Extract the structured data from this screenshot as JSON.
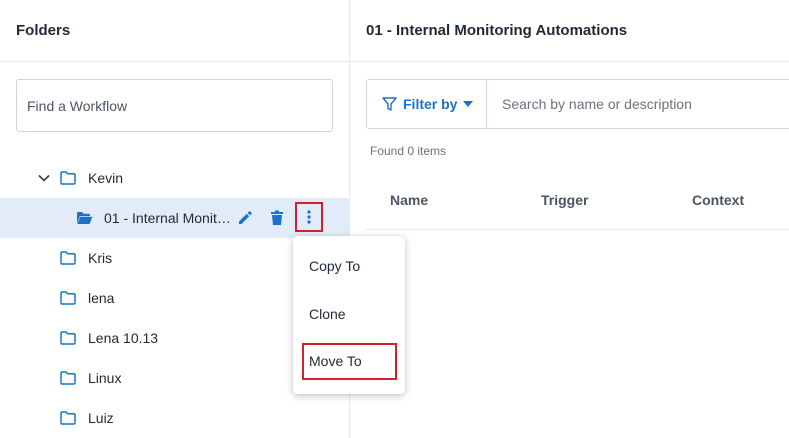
{
  "left_panel": {
    "title": "Folders",
    "search_placeholder": "Find a Workflow",
    "tree": [
      {
        "label": "Kevin",
        "expanded": true,
        "icon": "folder-outline-icon"
      },
      {
        "label": "01 - Internal Monit…",
        "selected": true,
        "icon": "folder-open-icon"
      },
      {
        "label": "Kris",
        "icon": "folder-outline-icon"
      },
      {
        "label": "lena",
        "icon": "folder-outline-icon"
      },
      {
        "label": "Lena 10.13",
        "icon": "folder-outline-icon"
      },
      {
        "label": "Linux",
        "icon": "folder-outline-icon"
      },
      {
        "label": "Luiz",
        "icon": "folder-outline-icon"
      }
    ],
    "context_menu": {
      "items": [
        "Copy To",
        "Clone",
        "Move To"
      ],
      "highlighted": "Move To"
    }
  },
  "right_panel": {
    "title": "01 - Internal Monitoring Automations",
    "filter_label": "Filter by",
    "search_placeholder": "Search by name or description",
    "found_text": "Found 0 items",
    "columns": [
      "Name",
      "Trigger",
      "Context"
    ]
  },
  "colors": {
    "accent": "#1a73c8",
    "selected_row": "#e1ecf8",
    "highlight_border": "#d0222a"
  }
}
